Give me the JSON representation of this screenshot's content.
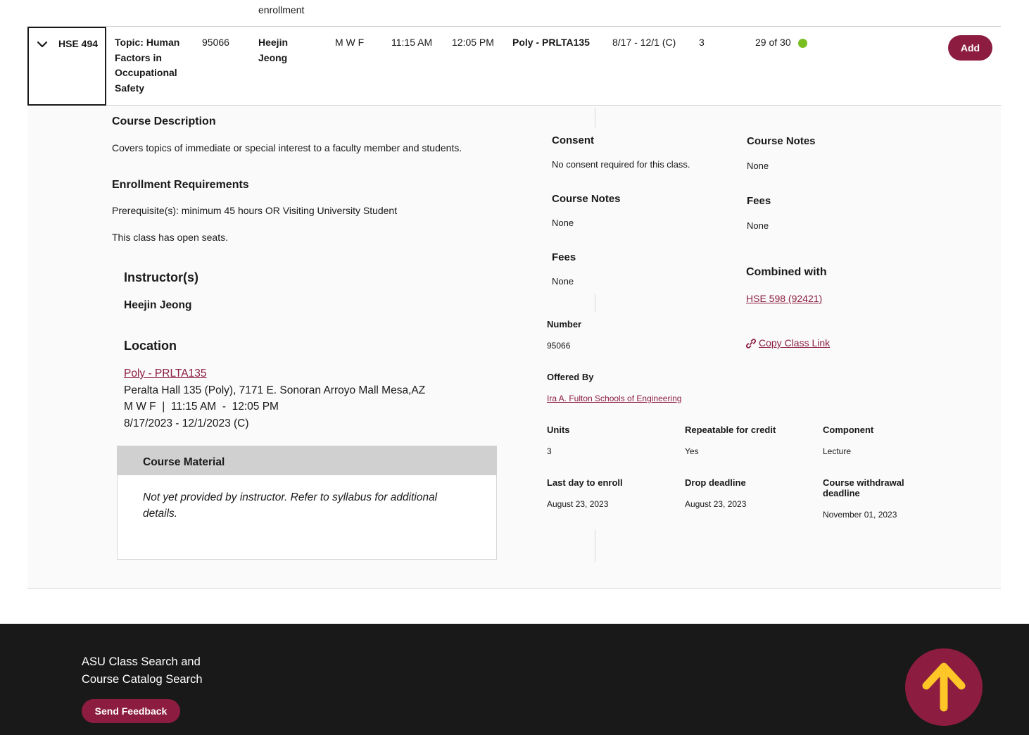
{
  "top_fragment": "enrollment",
  "course": {
    "code": "HSE 494",
    "title_lines": [
      "Topic: Human",
      "Factors in",
      "Occupational",
      "Safety"
    ],
    "number": "95066",
    "instructor_lines": [
      "Heejin",
      "Jeong"
    ],
    "days": "M W F",
    "start": "11:15 AM",
    "end": "12:05 PM",
    "location": "Poly - PRLTA135",
    "dates": "8/17 - 12/1 (C)",
    "units": "3",
    "seats": "29 of 30",
    "seat_status_color": "#78be20",
    "add_label": "Add",
    "toggle_icon": "chevron-down-icon"
  },
  "details": {
    "description_heading": "Course Description",
    "description": "Covers topics of immediate or special interest to a faculty member and students.",
    "enrollment_heading": "Enrollment Requirements",
    "prerequisite": "Prerequisite(s): minimum 45 hours OR Visiting University Student",
    "open_seats": "This class has open seats.",
    "instructors_heading": "Instructor(s)",
    "instructor_name": "Heejin Jeong",
    "location_heading": "Location",
    "location_link": "Poly - PRLTA135",
    "location_address": "Peralta Hall 135 (Poly), 7171 E. Sonoran Arroyo Mall Mesa,AZ",
    "location_schedule": "M W F  |  11:15 AM  -  12:05 PM",
    "location_dates": "8/17/2023 - 12/1/2023 (C)",
    "material_heading": "Course Material",
    "material_text_1": "Not yet provided by instructor. Refer to syllabus for additional",
    "material_text_2": "details.",
    "consent_heading": "Consent",
    "consent_text": "No consent required for this class.",
    "notes_heading_left": "Course Notes",
    "notes_text_left": "None",
    "fees_heading_left": "Fees",
    "fees_text_left": "None",
    "notes_heading_right": "Course Notes",
    "notes_text_right": "None",
    "fees_heading_right": "Fees",
    "fees_text_right": "None",
    "combined_heading": "Combined with",
    "combined_link": "HSE 598 (92421)",
    "copy_link": "Copy Class Link",
    "number_heading": "Number",
    "number_value": "95066",
    "offered_heading": "Offered By",
    "offered_link": "Ira A. Fulton Schools of Engineering",
    "units_heading": "Units",
    "units_value": "3",
    "repeatable_heading": "Repeatable for credit",
    "repeatable_value": "Yes",
    "component_heading": "Component",
    "component_value": "Lecture",
    "last_day_heading": "Last day to enroll",
    "last_day_value": "August 23, 2023",
    "drop_heading": "Drop deadline",
    "drop_value": "August 23, 2023",
    "withdraw_heading_1": "Course withdrawal",
    "withdraw_heading_2": "deadline",
    "withdraw_value": "November 01, 2023"
  },
  "footer": {
    "title_line_1": "ASU Class Search and",
    "title_line_2": "Course Catalog Search",
    "feedback_label": "Send Feedback",
    "back_to_top_icon": "arrow-up-icon",
    "accent": "#8c1d40",
    "arrow_color": "#ffc627"
  }
}
